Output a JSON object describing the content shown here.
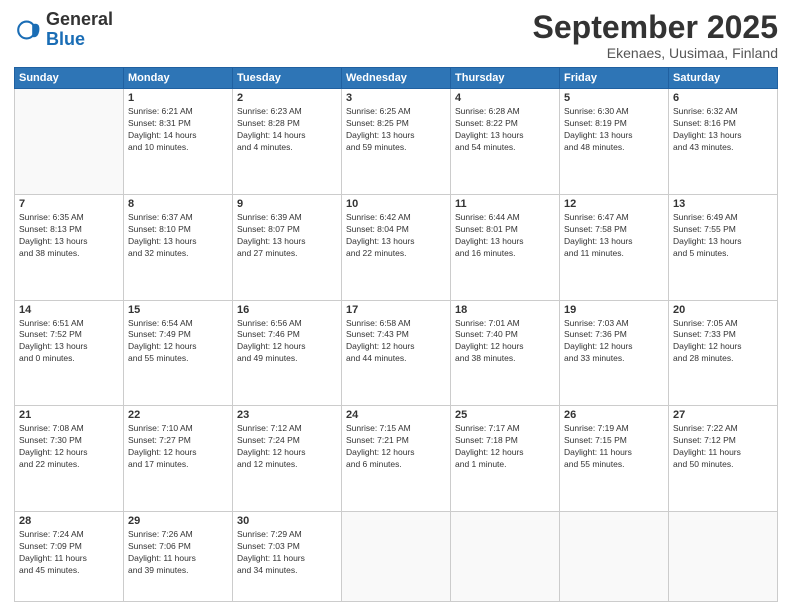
{
  "header": {
    "logo_general": "General",
    "logo_blue": "Blue",
    "month_title": "September 2025",
    "location": "Ekenaes, Uusimaa, Finland"
  },
  "weekdays": [
    "Sunday",
    "Monday",
    "Tuesday",
    "Wednesday",
    "Thursday",
    "Friday",
    "Saturday"
  ],
  "weeks": [
    [
      {
        "day": "",
        "info": ""
      },
      {
        "day": "1",
        "info": "Sunrise: 6:21 AM\nSunset: 8:31 PM\nDaylight: 14 hours\nand 10 minutes."
      },
      {
        "day": "2",
        "info": "Sunrise: 6:23 AM\nSunset: 8:28 PM\nDaylight: 14 hours\nand 4 minutes."
      },
      {
        "day": "3",
        "info": "Sunrise: 6:25 AM\nSunset: 8:25 PM\nDaylight: 13 hours\nand 59 minutes."
      },
      {
        "day": "4",
        "info": "Sunrise: 6:28 AM\nSunset: 8:22 PM\nDaylight: 13 hours\nand 54 minutes."
      },
      {
        "day": "5",
        "info": "Sunrise: 6:30 AM\nSunset: 8:19 PM\nDaylight: 13 hours\nand 48 minutes."
      },
      {
        "day": "6",
        "info": "Sunrise: 6:32 AM\nSunset: 8:16 PM\nDaylight: 13 hours\nand 43 minutes."
      }
    ],
    [
      {
        "day": "7",
        "info": "Sunrise: 6:35 AM\nSunset: 8:13 PM\nDaylight: 13 hours\nand 38 minutes."
      },
      {
        "day": "8",
        "info": "Sunrise: 6:37 AM\nSunset: 8:10 PM\nDaylight: 13 hours\nand 32 minutes."
      },
      {
        "day": "9",
        "info": "Sunrise: 6:39 AM\nSunset: 8:07 PM\nDaylight: 13 hours\nand 27 minutes."
      },
      {
        "day": "10",
        "info": "Sunrise: 6:42 AM\nSunset: 8:04 PM\nDaylight: 13 hours\nand 22 minutes."
      },
      {
        "day": "11",
        "info": "Sunrise: 6:44 AM\nSunset: 8:01 PM\nDaylight: 13 hours\nand 16 minutes."
      },
      {
        "day": "12",
        "info": "Sunrise: 6:47 AM\nSunset: 7:58 PM\nDaylight: 13 hours\nand 11 minutes."
      },
      {
        "day": "13",
        "info": "Sunrise: 6:49 AM\nSunset: 7:55 PM\nDaylight: 13 hours\nand 5 minutes."
      }
    ],
    [
      {
        "day": "14",
        "info": "Sunrise: 6:51 AM\nSunset: 7:52 PM\nDaylight: 13 hours\nand 0 minutes."
      },
      {
        "day": "15",
        "info": "Sunrise: 6:54 AM\nSunset: 7:49 PM\nDaylight: 12 hours\nand 55 minutes."
      },
      {
        "day": "16",
        "info": "Sunrise: 6:56 AM\nSunset: 7:46 PM\nDaylight: 12 hours\nand 49 minutes."
      },
      {
        "day": "17",
        "info": "Sunrise: 6:58 AM\nSunset: 7:43 PM\nDaylight: 12 hours\nand 44 minutes."
      },
      {
        "day": "18",
        "info": "Sunrise: 7:01 AM\nSunset: 7:40 PM\nDaylight: 12 hours\nand 38 minutes."
      },
      {
        "day": "19",
        "info": "Sunrise: 7:03 AM\nSunset: 7:36 PM\nDaylight: 12 hours\nand 33 minutes."
      },
      {
        "day": "20",
        "info": "Sunrise: 7:05 AM\nSunset: 7:33 PM\nDaylight: 12 hours\nand 28 minutes."
      }
    ],
    [
      {
        "day": "21",
        "info": "Sunrise: 7:08 AM\nSunset: 7:30 PM\nDaylight: 12 hours\nand 22 minutes."
      },
      {
        "day": "22",
        "info": "Sunrise: 7:10 AM\nSunset: 7:27 PM\nDaylight: 12 hours\nand 17 minutes."
      },
      {
        "day": "23",
        "info": "Sunrise: 7:12 AM\nSunset: 7:24 PM\nDaylight: 12 hours\nand 12 minutes."
      },
      {
        "day": "24",
        "info": "Sunrise: 7:15 AM\nSunset: 7:21 PM\nDaylight: 12 hours\nand 6 minutes."
      },
      {
        "day": "25",
        "info": "Sunrise: 7:17 AM\nSunset: 7:18 PM\nDaylight: 12 hours\nand 1 minute."
      },
      {
        "day": "26",
        "info": "Sunrise: 7:19 AM\nSunset: 7:15 PM\nDaylight: 11 hours\nand 55 minutes."
      },
      {
        "day": "27",
        "info": "Sunrise: 7:22 AM\nSunset: 7:12 PM\nDaylight: 11 hours\nand 50 minutes."
      }
    ],
    [
      {
        "day": "28",
        "info": "Sunrise: 7:24 AM\nSunset: 7:09 PM\nDaylight: 11 hours\nand 45 minutes."
      },
      {
        "day": "29",
        "info": "Sunrise: 7:26 AM\nSunset: 7:06 PM\nDaylight: 11 hours\nand 39 minutes."
      },
      {
        "day": "30",
        "info": "Sunrise: 7:29 AM\nSunset: 7:03 PM\nDaylight: 11 hours\nand 34 minutes."
      },
      {
        "day": "",
        "info": ""
      },
      {
        "day": "",
        "info": ""
      },
      {
        "day": "",
        "info": ""
      },
      {
        "day": "",
        "info": ""
      }
    ]
  ]
}
